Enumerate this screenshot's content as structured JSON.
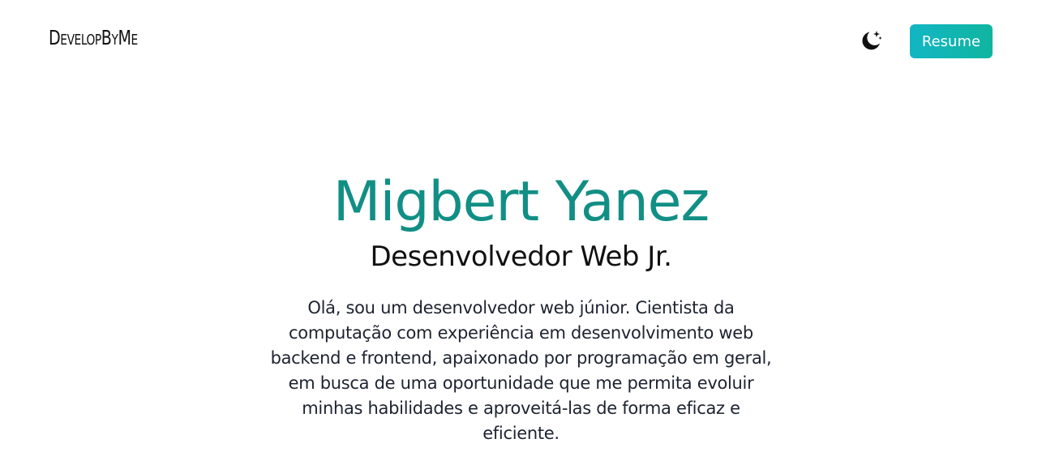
{
  "header": {
    "logo_text": "DevelopByMe",
    "theme_toggle_icon": "moon-stars-icon",
    "resume_label": "Resume"
  },
  "hero": {
    "name": "Migbert Yanez",
    "role": "Desenvolvedor Web Jr.",
    "bio": "Olá, sou um desenvolvedor web júnior. Cientista da computação com experiência em desenvolvimento web backend e frontend, apaixonado por programação em geral, em busca de uma oportunidade que me permita evoluir minhas habilidades e aproveitá-las de forma eficaz e eficiente."
  },
  "colors": {
    "accent": "#118f85",
    "button_gradient_start": "#12b6c4",
    "button_gradient_end": "#10b5a0"
  }
}
